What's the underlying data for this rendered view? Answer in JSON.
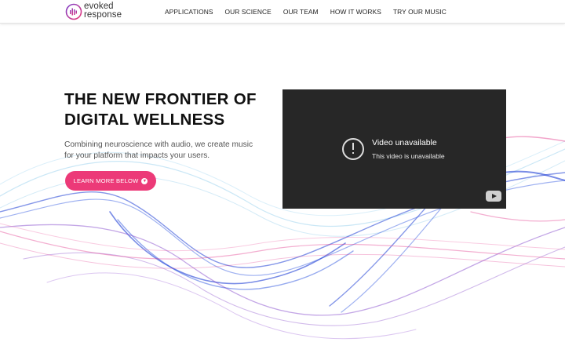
{
  "brand": {
    "name_line1": "evoked",
    "name_line2": "response",
    "logo_colors": [
      "#7a3cc9",
      "#ec3a78"
    ]
  },
  "nav": {
    "items": [
      {
        "label": "APPLICATIONS"
      },
      {
        "label": "OUR SCIENCE"
      },
      {
        "label": "OUR TEAM"
      },
      {
        "label": "HOW IT WORKS"
      },
      {
        "label": "TRY OUR MUSIC"
      }
    ]
  },
  "hero": {
    "title_line1": "THE NEW FRONTIER OF",
    "title_line2": "DIGITAL WELLNESS",
    "subtitle_line1": "Combining neuroscience with audio, we create music",
    "subtitle_line2": "for your platform that impacts your users.",
    "cta_label": "LEARN MORE BELOW",
    "cta_icon": "chevron-down-circle-icon",
    "cta_color": "#ec3a78"
  },
  "video": {
    "title": "Video unavailable",
    "message": "This video is unavailable",
    "alert_icon": "alert-icon",
    "logo_icon": "youtube-logo-icon",
    "background": "#272727"
  },
  "colors": {
    "wave_blue": "#1f3fd6",
    "wave_purple": "#7b39c7",
    "wave_pink": "#e2358a"
  }
}
